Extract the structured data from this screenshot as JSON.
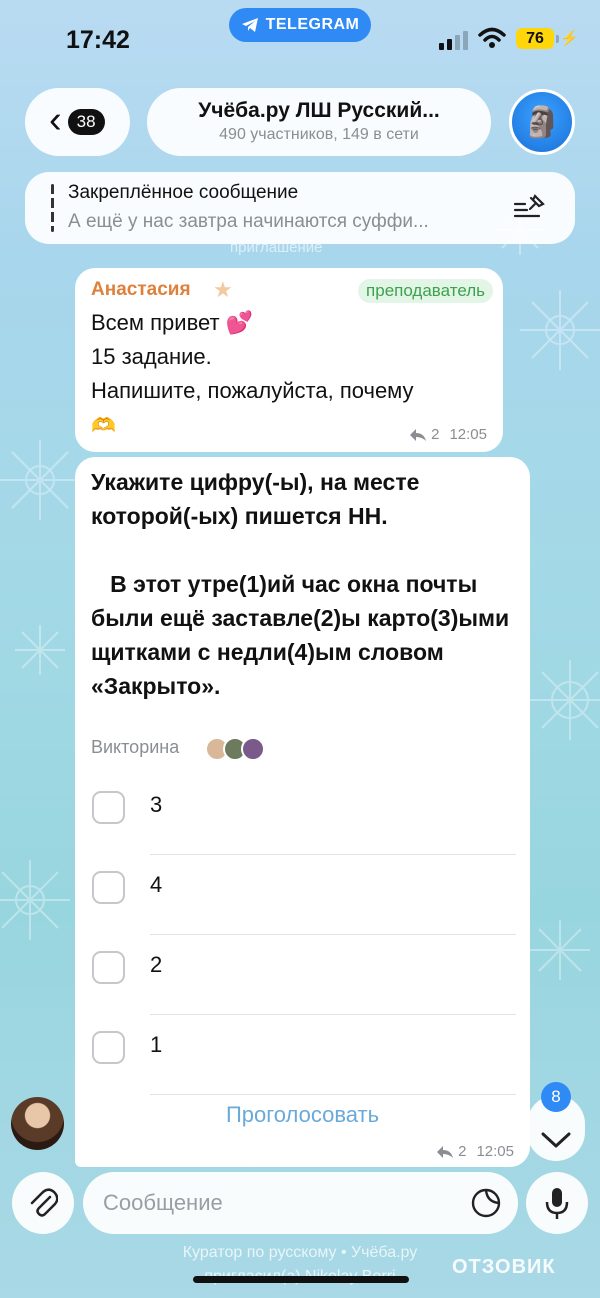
{
  "status_bar": {
    "time": "17:42",
    "app_pill": "TELEGRAM",
    "battery": "76"
  },
  "header": {
    "back_count": "38",
    "title": "Учёба.ру ЛШ Русский...",
    "subtitle": "490 участников, 149 в сети"
  },
  "pinned": {
    "title": "Закреплённое сообщение",
    "text": "А ещё у нас завтра начинаются суффи..."
  },
  "partial_behind": "приглашение",
  "message1": {
    "sender": "Анастасия",
    "role": "преподаватель",
    "lines": [
      "Всем привет 💕",
      "15 задание.",
      "Напишите, пожалуйста, почему",
      "🫶"
    ],
    "replies": "2",
    "time": "12:05"
  },
  "quiz": {
    "question": "Укажите цифру(-ы), на месте которой(-ых) пишется НН.\n\n   В этот утре(1)ий час окна почты были ещё заставле(2)ы карто(3)ыми щитками с недли(4)ым словом «Закрыто».",
    "type": "Викторина",
    "options": [
      "3",
      "4",
      "2",
      "1"
    ],
    "vote_label": "Проголосовать",
    "replies": "2",
    "time": "12:05"
  },
  "scroll_down_unread": "8",
  "input": {
    "placeholder": "Сообщение"
  },
  "footer": {
    "line1": "Куратор по русскому • Учёба.ру",
    "line2": "пригласил(а) Nikolay Berri"
  },
  "watermark": "ОТЗОВИК",
  "colors": {
    "accent": "#2f8af6",
    "sender": "#e0813b",
    "role_bg": "#e3f5e6",
    "role_text": "#3ca34d",
    "vote": "#6aaad9"
  },
  "icons": [
    "telegram-icon",
    "signal-icon",
    "wifi-icon",
    "battery-icon",
    "back-chevron-icon",
    "pin-list-icon",
    "reply-icon",
    "chevron-down-icon",
    "paperclip-icon",
    "sticker-icon",
    "microphone-icon"
  ]
}
